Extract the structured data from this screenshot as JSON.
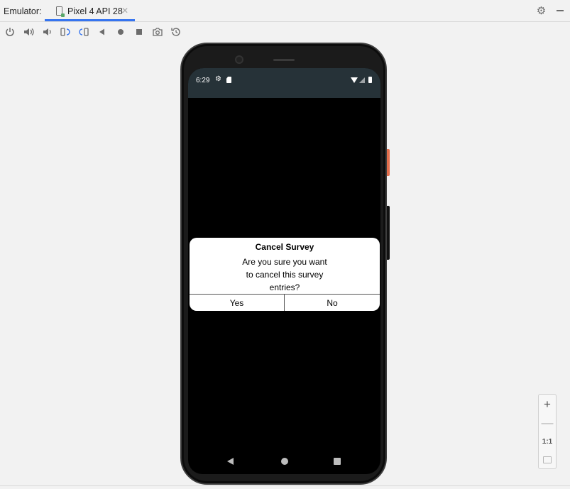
{
  "window": {
    "label": "Emulator:",
    "tab": {
      "title": "Pixel 4 API 28",
      "close": "✕"
    },
    "settings_icon": "gear-icon",
    "accent_color": "#3574f0"
  },
  "toolbar": {
    "buttons": [
      {
        "name": "power-icon",
        "title": "Power"
      },
      {
        "name": "volume-up-icon",
        "title": "Volume Up"
      },
      {
        "name": "volume-down-icon",
        "title": "Volume Down"
      },
      {
        "name": "rotate-left-icon",
        "title": "Rotate Left"
      },
      {
        "name": "rotate-right-icon",
        "title": "Rotate Right"
      },
      {
        "name": "back-icon",
        "title": "Back"
      },
      {
        "name": "home-icon",
        "title": "Home"
      },
      {
        "name": "overview-icon",
        "title": "Overview"
      },
      {
        "name": "camera-icon",
        "title": "Take Screenshot"
      },
      {
        "name": "snapshot-icon",
        "title": "Snapshots"
      }
    ]
  },
  "device": {
    "status_bar": {
      "time": "6:29",
      "gear": "⚙"
    },
    "dialog": {
      "title": "Cancel Survey",
      "message_lines": [
        "Are you sure you want",
        "to cancel this survey",
        "entries?"
      ],
      "yes": "Yes",
      "no": "No"
    },
    "status_bar_color": "#263238",
    "power_button_color": "#e46f4d"
  },
  "zoom": {
    "zoom_in": "+",
    "zoom_out": "—",
    "actual": "1:1"
  }
}
